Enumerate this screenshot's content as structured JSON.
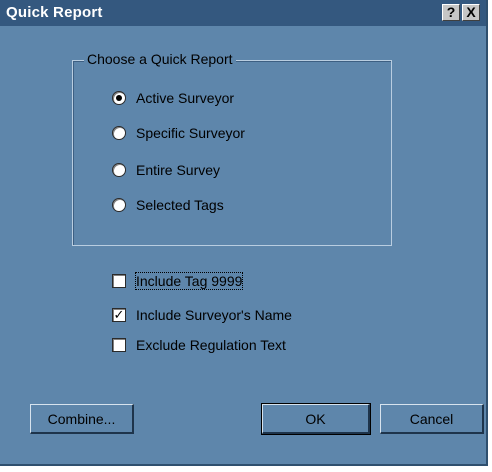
{
  "window": {
    "title": "Quick Report",
    "help_button": "?",
    "close_button": "X"
  },
  "report_group": {
    "label": "Choose a Quick Report",
    "options": [
      {
        "label": "Active Surveyor",
        "selected": true
      },
      {
        "label": "Specific Surveyor",
        "selected": false
      },
      {
        "label": "Entire Survey",
        "selected": false
      },
      {
        "label": "Selected Tags",
        "selected": false
      }
    ]
  },
  "checkboxes": [
    {
      "label": "Include Tag 9999",
      "checked": false
    },
    {
      "label": "Include Surveyor's Name",
      "checked": true
    },
    {
      "label": "Exclude Regulation Text",
      "checked": false
    }
  ],
  "buttons": {
    "combine": "Combine...",
    "ok": "OK",
    "cancel": "Cancel"
  },
  "colors": {
    "dialog_background": "#5e86ab",
    "titlebar": "#34587f"
  }
}
